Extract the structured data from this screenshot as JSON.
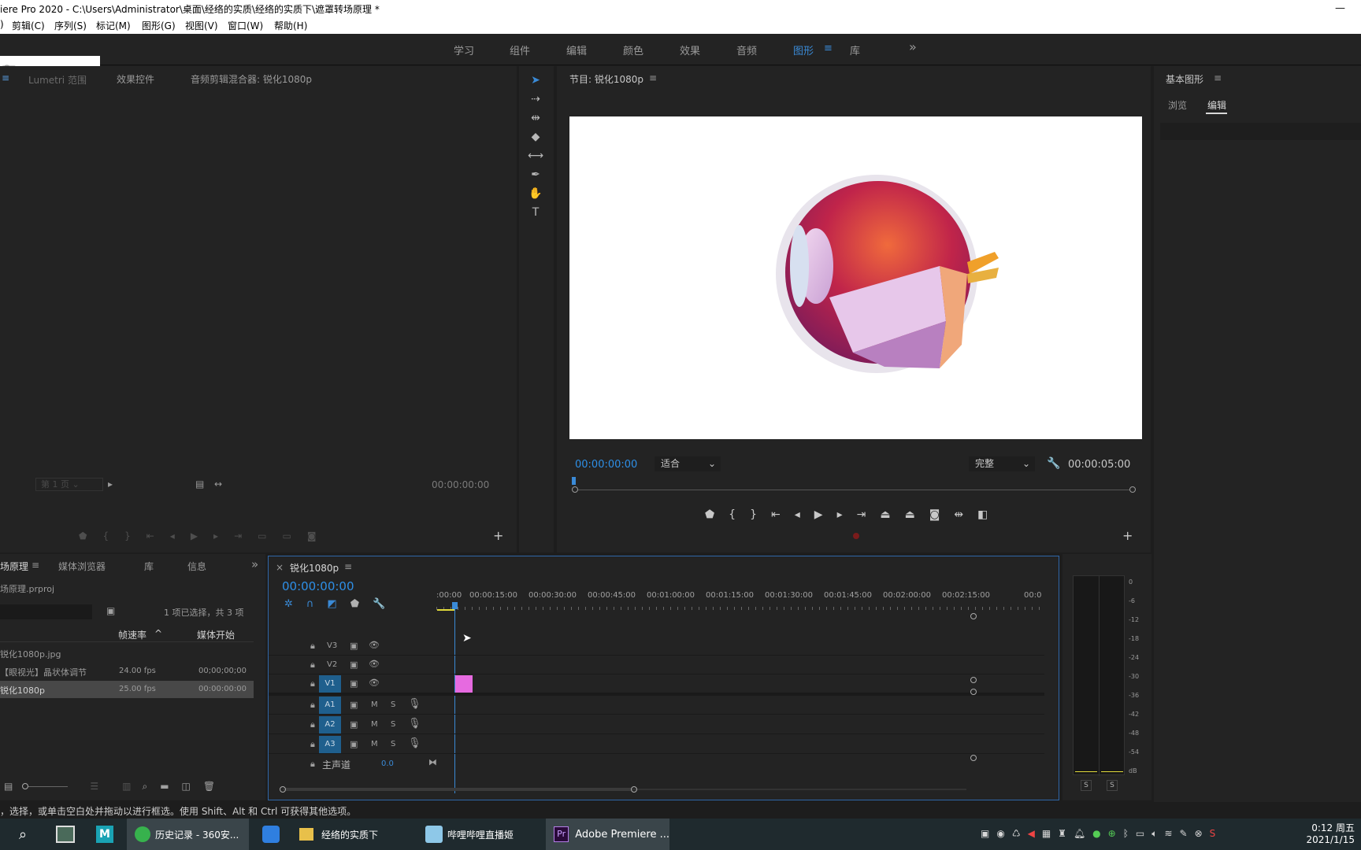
{
  "window": {
    "title": "iere Pro 2020 - C:\\Users\\Administrator\\桌面\\经络的实质\\经络的实质下\\遮罩转场原理 *",
    "minimize": "—"
  },
  "menu": [
    "剪辑(C)",
    "序列(S)",
    "标记(M)",
    "图形(G)",
    "视图(V)",
    "窗口(W)",
    "帮助(H)"
  ],
  "workspaces": {
    "items": [
      "学习",
      "组件",
      "编辑",
      "颜色",
      "效果",
      "音频",
      "图形",
      "库"
    ],
    "active": "图形",
    "more": "»"
  },
  "source_panel": {
    "tabs": [
      "Lumetri 范围",
      "效果控件",
      "音频剪辑混合器: 锐化1080p"
    ],
    "page_select": "第 1 页",
    "timecode": "00:00:00:00"
  },
  "program_monitor": {
    "title": "节目: 锐化1080p",
    "timecode": "00:00:00:00",
    "fit": "适合",
    "quality": "完整",
    "duration": "00:00:05:00"
  },
  "essential_graphics": {
    "title": "基本图形",
    "tabs": [
      "浏览",
      "编辑"
    ],
    "active_tab": "编辑"
  },
  "project_panel": {
    "tabs": [
      "场原理",
      "媒体浏览器",
      "库",
      "信息"
    ],
    "file": "场原理.prproj",
    "selection": "1 项已选择，共 3 项",
    "columns": [
      "帧速率",
      "媒体开始"
    ],
    "items": [
      {
        "name": "锐化1080p.jpg",
        "fps": "",
        "start": ""
      },
      {
        "name": "【眼视光】晶状体调节",
        "fps": "24.00 fps",
        "start": "00;00;00;00"
      },
      {
        "name": "锐化1080p",
        "fps": "25.00 fps",
        "start": "00:00:00:00"
      }
    ]
  },
  "timeline": {
    "close": "×",
    "sequence": "锐化1080p",
    "timecode": "00:00:00:00",
    "ruler": [
      ":00:00",
      "00:00:15:00",
      "00:00:30:00",
      "00:00:45:00",
      "00:01:00:00",
      "00:01:15:00",
      "00:01:30:00",
      "00:01:45:00",
      "00:02:00:00",
      "00:02:15:00",
      "00:0"
    ],
    "video_tracks": [
      "V3",
      "V2",
      "V1"
    ],
    "audio_tracks": [
      "A1",
      "A2",
      "A3"
    ],
    "mute": "M",
    "solo": "S",
    "master": {
      "label": "主声道",
      "value": "0.0"
    },
    "clip_color": "#e66ae0"
  },
  "meters": {
    "scale": [
      "0",
      "-6",
      "-12",
      "-18",
      "-24",
      "-30",
      "-36",
      "-42",
      "-48",
      "-54",
      "dB"
    ],
    "solo": [
      "S",
      "S"
    ]
  },
  "status_bar": "，选择，或单击空白处并拖动以进行框选。使用 Shift、Alt 和 Ctrl 可获得其他选项。",
  "taskbar": {
    "apps": [
      "历史记录 - 360安...",
      "经络的实质下",
      "哔哩哔哩直播姬",
      "Adobe Premiere ..."
    ],
    "clock_time": "0:12 周五",
    "clock_date": "2021/1/15"
  },
  "colors": {
    "accent": "#2e8fe6",
    "panel": "#232323",
    "bg": "#1d1d1d",
    "clip": "#e66ae0"
  }
}
